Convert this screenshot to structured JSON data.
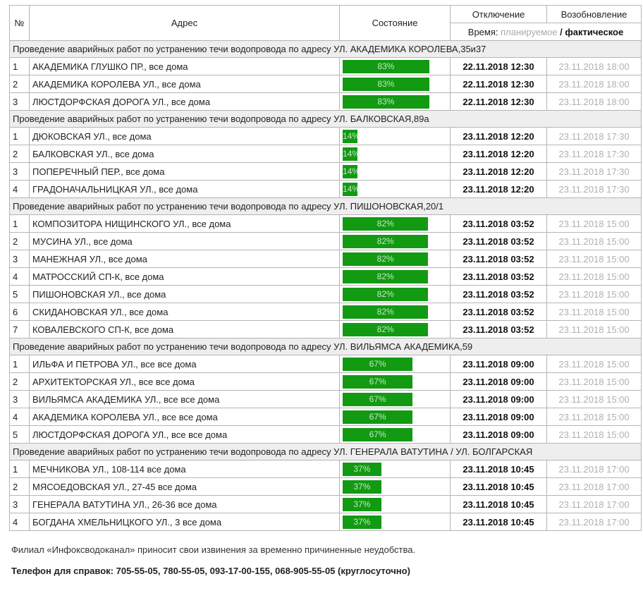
{
  "headers": {
    "num": "№",
    "address": "Адрес",
    "state": "Состояние",
    "shutdown": "Отключение",
    "restore": "Возобновление",
    "time_prefix": "Время:",
    "time_planned": "планируемое",
    "time_slash": "/",
    "time_actual": "фактическое"
  },
  "groups": [
    {
      "title": "Проведение аварийных работ по устранению течи водопровода по адресу УЛ. АКАДЕМИКА КОРОЛЕВА,35и37",
      "progress": 83,
      "rows": [
        {
          "num": "1",
          "address": "АКАДЕМИКА ГЛУШКО ПР., все дома",
          "progress": "83%",
          "off": "22.11.2018 12:30",
          "on": "23.11.2018 18:00"
        },
        {
          "num": "2",
          "address": "АКАДЕМИКА КОРОЛЕВА УЛ., все дома",
          "progress": "83%",
          "off": "22.11.2018 12:30",
          "on": "23.11.2018 18:00"
        },
        {
          "num": "3",
          "address": "ЛЮСТДОРФСКАЯ ДОРОГА УЛ., все дома",
          "progress": "83%",
          "off": "22.11.2018 12:30",
          "on": "23.11.2018 18:00"
        }
      ]
    },
    {
      "title": "Проведение аварийных работ по устранению течи водопровода по адресу УЛ. БАЛКОВСКАЯ,89а",
      "progress": 14,
      "rows": [
        {
          "num": "1",
          "address": "ДЮКОВСКАЯ УЛ., все дома",
          "progress": "14%",
          "off": "23.11.2018 12:20",
          "on": "23.11.2018 17:30"
        },
        {
          "num": "2",
          "address": "БАЛКОВСКАЯ УЛ., все дома",
          "progress": "14%",
          "off": "23.11.2018 12:20",
          "on": "23.11.2018 17:30"
        },
        {
          "num": "3",
          "address": "ПОПЕРЕЧНЫЙ ПЕР., все дома",
          "progress": "14%",
          "off": "23.11.2018 12:20",
          "on": "23.11.2018 17:30"
        },
        {
          "num": "4",
          "address": "ГРАДОНАЧАЛЬНИЦКАЯ УЛ., все дома",
          "progress": "14%",
          "off": "23.11.2018 12:20",
          "on": "23.11.2018 17:30"
        }
      ]
    },
    {
      "title": "Проведение аварийных работ по устранению течи водопровода по адресу УЛ. ПИШОНОВСКАЯ,20/1",
      "progress": 82,
      "rows": [
        {
          "num": "1",
          "address": "КОМПОЗИТОРА НИЩИНСКОГО УЛ., все дома",
          "progress": "82%",
          "off": "23.11.2018 03:52",
          "on": "23.11.2018 15:00"
        },
        {
          "num": "2",
          "address": "МУСИНА УЛ., все дома",
          "progress": "82%",
          "off": "23.11.2018 03:52",
          "on": "23.11.2018 15:00"
        },
        {
          "num": "3",
          "address": "МАНЕЖНАЯ УЛ., все дома",
          "progress": "82%",
          "off": "23.11.2018 03:52",
          "on": "23.11.2018 15:00"
        },
        {
          "num": "4",
          "address": "МАТРОССКИЙ СП-К, все дома",
          "progress": "82%",
          "off": "23.11.2018 03:52",
          "on": "23.11.2018 15:00"
        },
        {
          "num": "5",
          "address": "ПИШОНОВСКАЯ УЛ., все дома",
          "progress": "82%",
          "off": "23.11.2018 03:52",
          "on": "23.11.2018 15:00"
        },
        {
          "num": "6",
          "address": "СКИДАНОВСКАЯ УЛ., все дома",
          "progress": "82%",
          "off": "23.11.2018 03:52",
          "on": "23.11.2018 15:00"
        },
        {
          "num": "7",
          "address": "КОВАЛЕВСКОГО СП-К, все дома",
          "progress": "82%",
          "off": "23.11.2018 03:52",
          "on": "23.11.2018 15:00"
        }
      ]
    },
    {
      "title": "Проведение аварийных работ по устранению течи водопровода по адресу УЛ. ВИЛЬЯМСА АКАДЕМИКА,59",
      "progress": 67,
      "rows": [
        {
          "num": "1",
          "address": "ИЛЬФА И ПЕТРОВА УЛ., все все дома",
          "progress": "67%",
          "off": "23.11.2018 09:00",
          "on": "23.11.2018 15:00"
        },
        {
          "num": "2",
          "address": "АРХИТЕКТОРСКАЯ УЛ., все все дома",
          "progress": "67%",
          "off": "23.11.2018 09:00",
          "on": "23.11.2018 15:00"
        },
        {
          "num": "3",
          "address": "ВИЛЬЯМСА АКАДЕМИКА УЛ., все все дома",
          "progress": "67%",
          "off": "23.11.2018 09:00",
          "on": "23.11.2018 15:00"
        },
        {
          "num": "4",
          "address": "АКАДЕМИКА КОРОЛЕВА УЛ., все все дома",
          "progress": "67%",
          "off": "23.11.2018 09:00",
          "on": "23.11.2018 15:00"
        },
        {
          "num": "5",
          "address": "ЛЮСТДОРФСКАЯ ДОРОГА УЛ., все все дома",
          "progress": "67%",
          "off": "23.11.2018 09:00",
          "on": "23.11.2018 15:00"
        }
      ]
    },
    {
      "title": "Проведение аварийных работ по устранению течи водопровода по адресу УЛ. ГЕНЕРАЛА ВАТУТИНА / УЛ. БОЛГАРСКАЯ",
      "progress": 37,
      "rows": [
        {
          "num": "1",
          "address": "МЕЧНИКОВА УЛ., 108-114 все дома",
          "progress": "37%",
          "off": "23.11.2018 10:45",
          "on": "23.11.2018 17:00"
        },
        {
          "num": "2",
          "address": "МЯСОЕДОВСКАЯ УЛ., 27-45 все дома",
          "progress": "37%",
          "off": "23.11.2018 10:45",
          "on": "23.11.2018 17:00"
        },
        {
          "num": "3",
          "address": "ГЕНЕРАЛА ВАТУТИНА УЛ., 26-36 все дома",
          "progress": "37%",
          "off": "23.11.2018 10:45",
          "on": "23.11.2018 17:00"
        },
        {
          "num": "4",
          "address": "БОГДАНА ХМЕЛЬНИЦКОГО УЛ., 3 все дома",
          "progress": "37%",
          "off": "23.11.2018 10:45",
          "on": "23.11.2018 17:00"
        }
      ]
    }
  ],
  "footer": {
    "apology": "Филиал «Инфоксводоканал» приносит свои извинения за временно причиненные неудобства.",
    "phones": "Телефон для справок: 705-55-05, 780-55-05, 093-17-00-155, 068-905-55-05 (круглосуточно)"
  },
  "colors": {
    "progress_bar": "#129a12",
    "progress_text": "#c8e6c8",
    "group_row_bg": "#eeeeee",
    "restore_text": "#b0b0b0",
    "border": "#b5b5b5"
  }
}
